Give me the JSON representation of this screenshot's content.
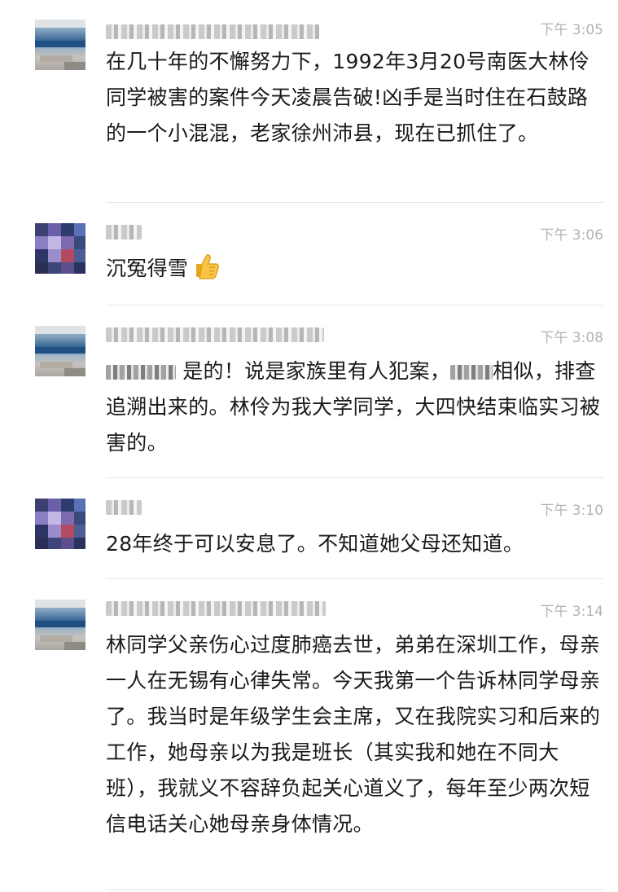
{
  "messages": [
    {
      "time": "下午 3:05",
      "text": "在几十年的不懈努力下，1992年3月20号南医大林伶同学被害的案件今天凌晨告破!凶手是当时住在石鼓路的一个小混混，老家徐州沛县，现在已抓住了。"
    },
    {
      "time": "下午 3:06",
      "text": "沉冤得雪"
    },
    {
      "time": "下午 3:08",
      "text_a": "是的！说是家族里有人犯案，",
      "text_b": "相似，排查追溯出来的。林伶为我大学同学，大四快结束临实习被害的。"
    },
    {
      "time": "下午 3:10",
      "text": "28年终于可以安息了。不知道她父母还知道。"
    },
    {
      "time": "下午 3:14",
      "text": "林同学父亲伤心过度肺癌去世，弟弟在深圳工作，母亲一人在无锡有心律失常。今天我第一个告诉林同学母亲了。我当时是年级学生会主席，又在我院实习和后来的工作，她母亲以为我是班长（其实我和她在不同大班），我就义不容辞负起关心道义了，每年至少两次短信电话关心她母亲身体情况。"
    }
  ]
}
